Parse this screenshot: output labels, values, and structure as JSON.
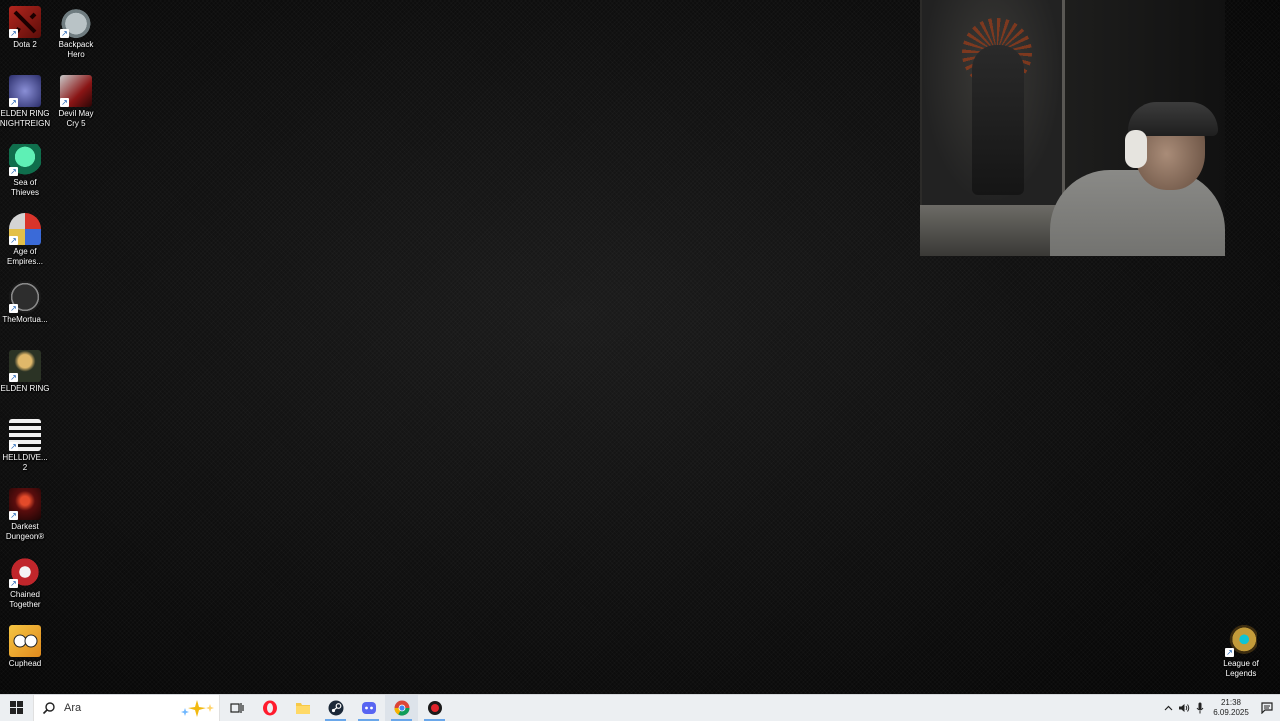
{
  "desktop": {
    "icons": [
      {
        "id": "dota2",
        "label": "Dota 2",
        "icon": "dota2-icon"
      },
      {
        "id": "backpack-hero",
        "label": "Backpack\nHero",
        "icon": "backpack-hero-icon"
      },
      {
        "id": "elden-ring-nightreign",
        "label": "ELDEN RING\nNIGHTREIGN",
        "icon": "elden-ring-nightreign-icon"
      },
      {
        "id": "devil-may-cry-5",
        "label": "Devil May\nCry 5",
        "icon": "devil-may-cry-5-icon"
      },
      {
        "id": "sea-of-thieves",
        "label": "Sea of\nThieves",
        "icon": "sea-of-thieves-icon"
      },
      {
        "id": "age-of-empires",
        "label": "Age of\nEmpires...",
        "icon": "age-of-empires-icon"
      },
      {
        "id": "the-mortuary",
        "label": "TheMortua...",
        "icon": "the-mortuary-icon"
      },
      {
        "id": "elden-ring",
        "label": "ELDEN RING",
        "icon": "elden-ring-icon"
      },
      {
        "id": "helldivers-2",
        "label": "HELLDIVE...\n2",
        "icon": "helldivers-2-icon"
      },
      {
        "id": "darkest-dungeon",
        "label": "Darkest\nDungeon®",
        "icon": "darkest-dungeon-icon"
      },
      {
        "id": "chained-together",
        "label": "Chained\nTogether",
        "icon": "chained-together-icon"
      },
      {
        "id": "cuphead",
        "label": "Cuphead",
        "icon": "cuphead-icon"
      },
      {
        "id": "league-of-legends",
        "label": "League of\nLegends",
        "icon": "league-of-legends-icon"
      }
    ]
  },
  "taskbar": {
    "search_placeholder": "Ara",
    "apps": [
      "windows-start-icon",
      "search-icon",
      "copilot-sparkle-icon",
      "task-view-icon",
      "opera-icon",
      "file-explorer-icon",
      "steam-icon",
      "discord-icon",
      "chrome-icon",
      "app-red-icon"
    ],
    "clock_time": "21:38",
    "clock_date": "6.09.2025",
    "tray": [
      "chevron-up-icon",
      "speaker-icon",
      "microphone-icon",
      "notification-icon"
    ]
  },
  "colors": {
    "taskbar_bg": "#eceff2",
    "active_indicator": "#6aa7ea"
  }
}
